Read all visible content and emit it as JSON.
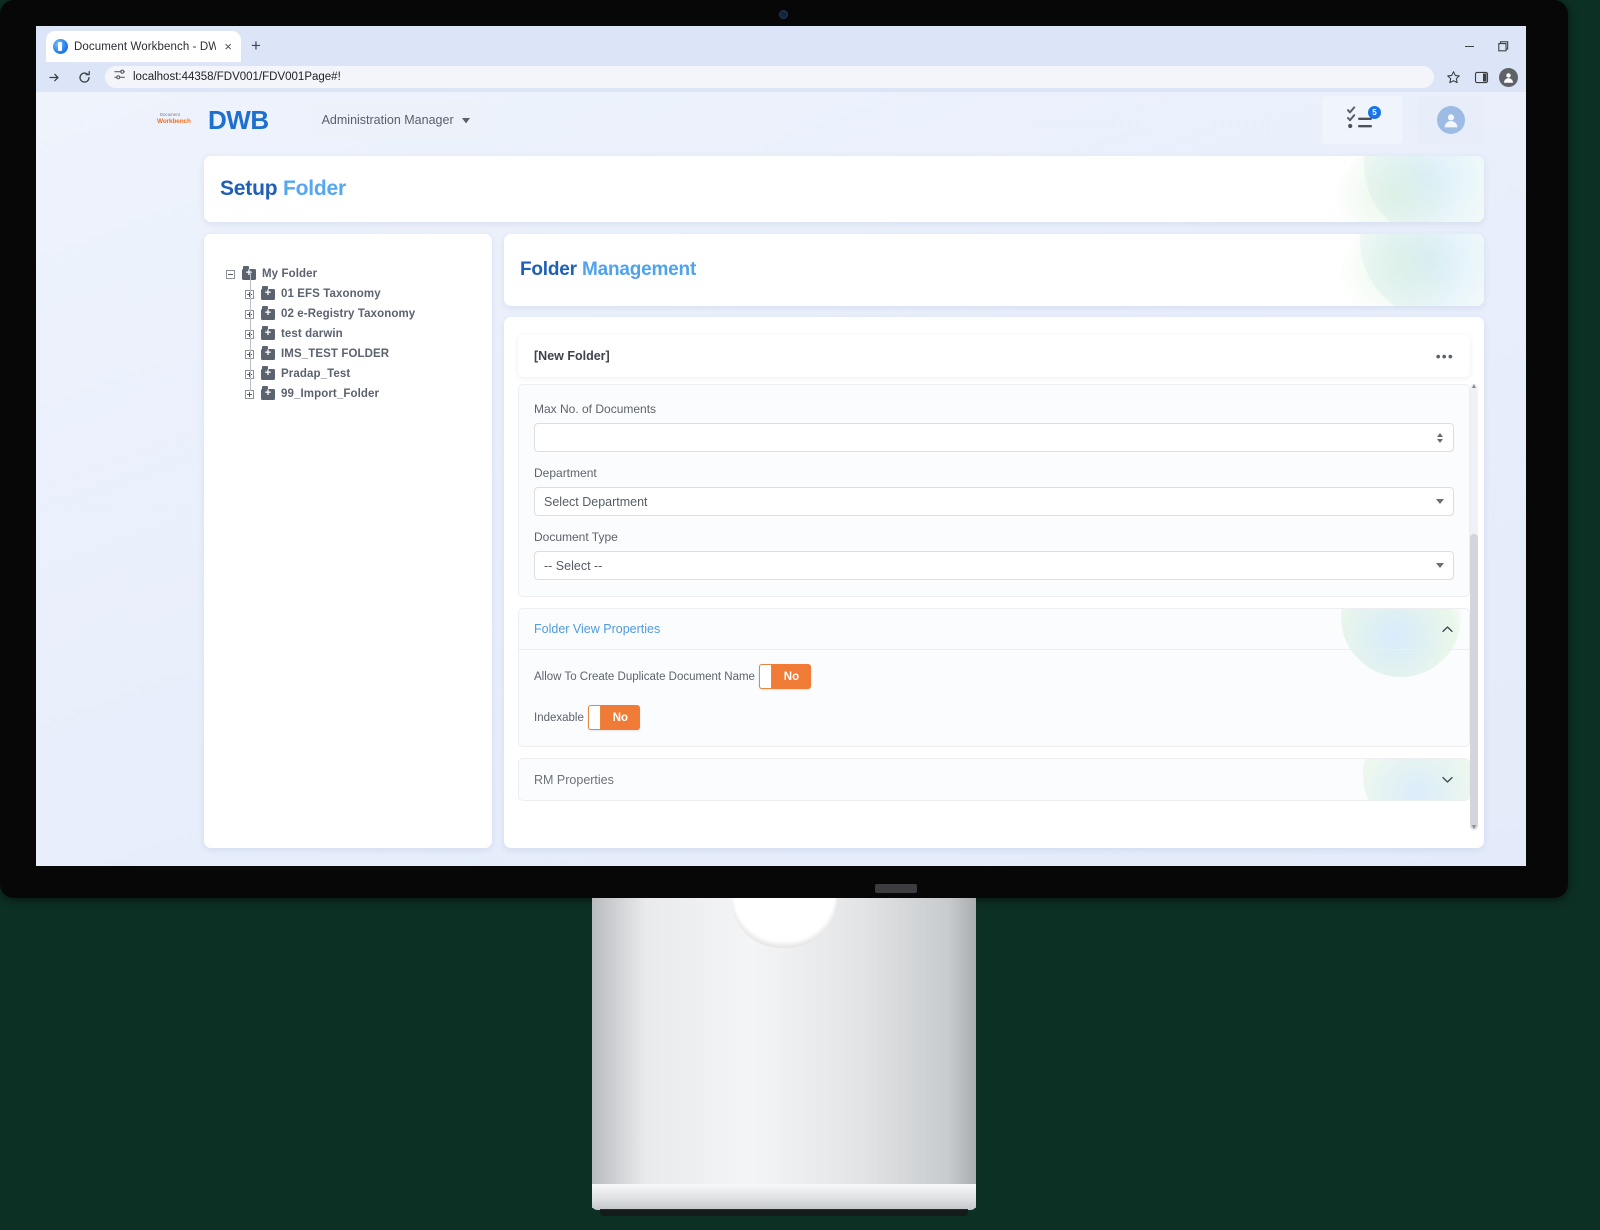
{
  "browser": {
    "tab": {
      "title": "Document Workbench - DWB.",
      "close_label": "×",
      "favicon": "globe-icon"
    },
    "new_tab_label": "+",
    "window_controls": {
      "minimize": "minimize-icon",
      "maximize": "maximize-icon"
    },
    "toolbar": {
      "forward": "forward-arrow-icon",
      "reload": "reload-icon",
      "site_settings": "tune-icon",
      "url": "localhost:44358/FDV001/FDV001Page#!",
      "bookmark": "star-icon",
      "side_panel": "side-panel-icon",
      "profile": "account-icon"
    }
  },
  "app": {
    "brand": {
      "tagline_line1": "Document",
      "tagline_line2": "Workbench",
      "name": "DWB"
    },
    "module_switcher": {
      "label": "Administration Manager",
      "caret": "▾"
    },
    "header_actions": {
      "tasks": {
        "icon": "checklist-icon",
        "badge": "5"
      },
      "account": {
        "icon": "user-avatar-icon"
      }
    },
    "page_title": {
      "strong": "Setup",
      "light": "Folder"
    },
    "tree": {
      "items": [
        {
          "label": "My Folder",
          "depth": 0,
          "toggle": "minus",
          "icon": "folder-add-icon"
        },
        {
          "label": "01 EFS Taxonomy",
          "depth": 1,
          "toggle": "plus",
          "icon": "folder-add-icon"
        },
        {
          "label": "02 e-Registry Taxonomy",
          "depth": 1,
          "toggle": "plus",
          "icon": "folder-add-icon"
        },
        {
          "label": "test darwin",
          "depth": 1,
          "toggle": "plus",
          "icon": "folder-add-icon"
        },
        {
          "label": "IMS_TEST FOLDER",
          "depth": 1,
          "toggle": "plus",
          "icon": "folder-add-icon"
        },
        {
          "label": "Pradap_Test",
          "depth": 1,
          "toggle": "plus",
          "icon": "folder-add-icon"
        },
        {
          "label": "99_Import_Folder",
          "depth": 1,
          "toggle": "plus",
          "icon": "folder-add-icon"
        }
      ]
    },
    "form": {
      "heading": {
        "strong": "Folder",
        "light": "Management"
      },
      "folder_name": {
        "value": "[New Folder]",
        "more_label": "•••"
      },
      "fields": [
        {
          "label": "Max No. of Documents",
          "value": "",
          "placeholder": "",
          "control": "number"
        },
        {
          "label": "Department",
          "value": "Select Department",
          "control": "select"
        },
        {
          "label": "Document Type",
          "value": "-- Select --",
          "control": "select"
        }
      ],
      "sections": [
        {
          "title": "Folder View Properties",
          "expanded": true,
          "chevron": "chevron-up-icon",
          "toggles": [
            {
              "label": "Allow To Create Duplicate Document Name",
              "value": "No",
              "state": "off"
            },
            {
              "label": "Indexable",
              "value": "No",
              "state": "off"
            }
          ]
        },
        {
          "title": "RM Properties",
          "expanded": false,
          "chevron": "chevron-down-icon",
          "toggles": []
        }
      ]
    },
    "colors": {
      "brand_blue": "#1d6fd0",
      "title_light_blue": "#56a7ef",
      "accent_orange": "#ef7b36",
      "badge_blue": "#1a73e8",
      "page_bg": "#eaf0fb"
    },
    "scrollbar": {
      "up": "▲",
      "down": "▼"
    }
  }
}
